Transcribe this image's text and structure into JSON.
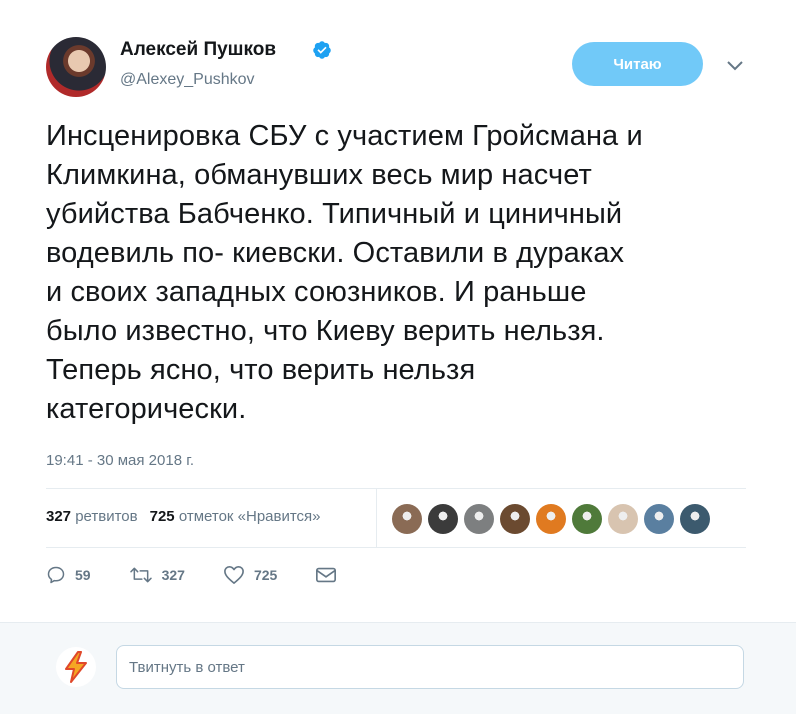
{
  "author": {
    "name": "Алексей Пушков",
    "handle": "@Alexey_Pushkov"
  },
  "follow_button": {
    "label": "Читаю"
  },
  "tweet": {
    "text": "Инсценировка СБУ с участием Гройсмана и\nКлимкина, обманувших весь мир насчет\nубийства Бабченко. Типичный и циничный\nводевиль по- киевски. Оставили в дураках\nи своих западных союзников. И раньше\nбыло известно, что Киеву верить нельзя.\nТеперь ясно, что верить нельзя\nкатегорически.",
    "timestamp": "19:41 - 30 мая 2018 г."
  },
  "stats": {
    "retweets_count": "327",
    "retweets_label": "ретвитов",
    "likes_count": "725",
    "likes_label": "отметок «Нравится»"
  },
  "likers_avatars": [
    {
      "icon": "user-avatar",
      "color": "#8a6b55"
    },
    {
      "icon": "cat-avatar",
      "color": "#3b3b3b"
    },
    {
      "icon": "road-avatar",
      "color": "#7d7f80"
    },
    {
      "icon": "landscape-avatar",
      "color": "#6b4a30"
    },
    {
      "icon": "ribbon-avatar",
      "color": "#e07a20"
    },
    {
      "icon": "tree-avatar",
      "color": "#4f7a3a"
    },
    {
      "icon": "person-avatar",
      "color": "#d8c4b0"
    },
    {
      "icon": "flag-avatar",
      "color": "#5a7fa0"
    },
    {
      "icon": "emblem-avatar",
      "color": "#3c5a6e"
    }
  ],
  "actions": {
    "reply_count": "59",
    "retweet_count": "327",
    "like_count": "725"
  },
  "reply": {
    "placeholder": "Твитнуть в ответ"
  },
  "colors": {
    "accent": "#1da1f2",
    "follow_button": "#71c9f8",
    "secondary_text": "#657786"
  }
}
